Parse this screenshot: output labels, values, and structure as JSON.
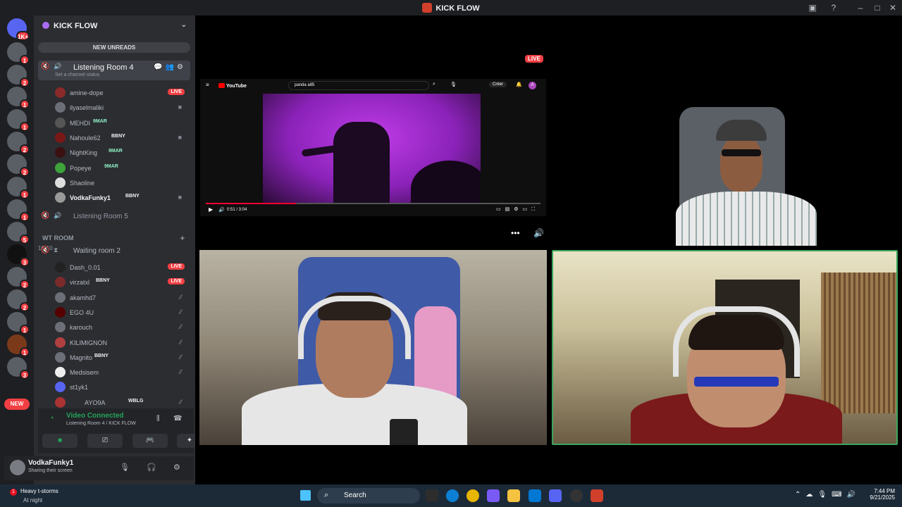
{
  "window": {
    "title": "KICK FLOW"
  },
  "guild": {
    "name": "KICK FLOW",
    "new_unreads": "NEW UNREADS"
  },
  "server_rail": {
    "home_badge": "1K+",
    "badges": [
      "1",
      "2",
      "1",
      "1",
      "2",
      "2",
      "1",
      "1",
      "5",
      "3",
      "2",
      "2",
      "1",
      "1",
      "3"
    ],
    "new_label": "NEW"
  },
  "channels": {
    "room4": {
      "name": "Listening Room 4",
      "status": "Set a channel status"
    },
    "room5": {
      "name": "Listening Room 5"
    },
    "category": {
      "name": "WT ROOM"
    },
    "waiting": {
      "name": "Waiting room 2",
      "count_a": "10",
      "count_b": "10"
    }
  },
  "room4_members": [
    {
      "name": "amine-dope",
      "tag": "",
      "live": "LIVE"
    },
    {
      "name": "ilyaselmaliki",
      "tag": "",
      "live": ""
    },
    {
      "name": "MEHDI",
      "tag": "9MAR",
      "live": ""
    },
    {
      "name": "Nahoule62",
      "tag": "BBNY",
      "live": ""
    },
    {
      "name": "NightKing",
      "tag": "9MAR",
      "live": ""
    },
    {
      "name": "Popeye",
      "tag": "9MAR",
      "live": ""
    },
    {
      "name": "Shaoline",
      "tag": "",
      "live": ""
    },
    {
      "name": "VodkaFunky1",
      "tag": "BBNY",
      "live": ""
    }
  ],
  "waiting_members": [
    {
      "name": "Dash_0.01",
      "tag": "",
      "live": "LIVE"
    },
    {
      "name": "virzatxl",
      "tag": "BBNY",
      "live": "LIVE"
    },
    {
      "name": "akamhd7",
      "tag": "",
      "live": ""
    },
    {
      "name": "EGO 4U",
      "tag": "",
      "live": ""
    },
    {
      "name": "karouch",
      "tag": "",
      "live": ""
    },
    {
      "name": "KILIMIGNON",
      "tag": "",
      "live": ""
    },
    {
      "name": "Magnito",
      "tag": "BBNY",
      "live": ""
    },
    {
      "name": "Medsisem",
      "tag": "",
      "live": ""
    },
    {
      "name": "st1yk1",
      "tag": "",
      "live": ""
    },
    {
      "name": "AYO9A",
      "tag": "WBLG",
      "live": ""
    }
  ],
  "voice": {
    "status": "Video Connected",
    "location": "Listening Room 4 / KICK FLOW"
  },
  "user": {
    "name": "VodkaFunky1",
    "status": "Sharing their screen"
  },
  "stage": {
    "live_badge": "LIVE",
    "youtube": {
      "logo": "YouTube",
      "search_value": "panda a85",
      "create_label": "Créer",
      "avatar_letter": "A",
      "time": "0:51 / 3:04",
      "progress": 0.27
    }
  },
  "taskbar": {
    "weather_title": "Heavy t-storms",
    "weather_sub": "At night",
    "weather_badge": "1",
    "search_label": "Search",
    "time": "7:44 PM",
    "date": "9/21/2025"
  },
  "colors": {
    "accent_green": "#23a55a",
    "live_red": "#f23f43",
    "blurple": "#5865f2"
  }
}
